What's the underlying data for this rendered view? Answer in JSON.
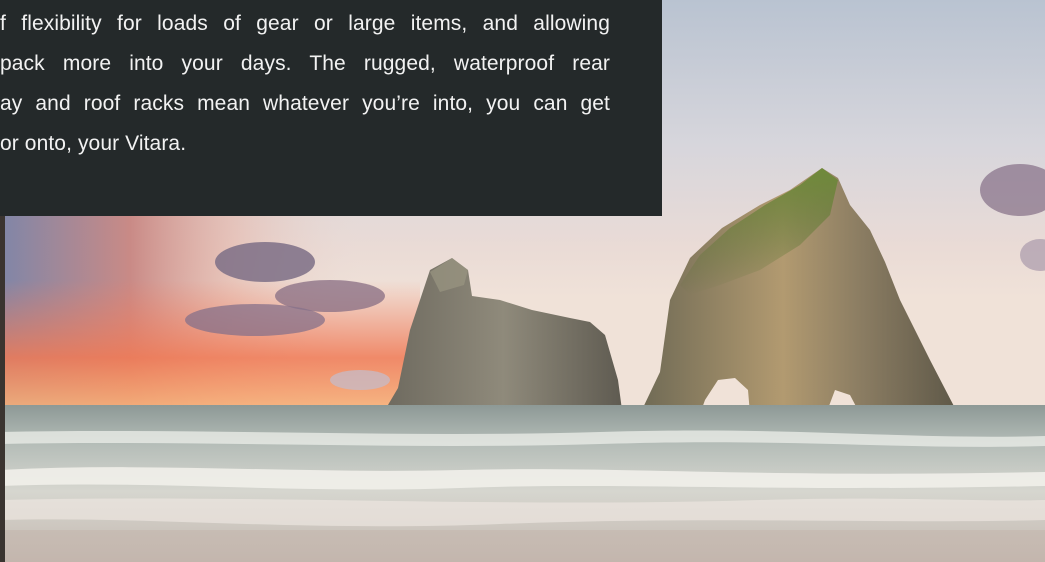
{
  "card": {
    "lines": [
      "f flexibility for loads of gear or large items, and allowing",
      "pack more into your days. The rugged, waterproof rear",
      "ay and roof racks mean whatever you’re into, you can get",
      "or onto, your Vitara."
    ]
  },
  "scene": {
    "description_colors": {
      "card_bg": "#24292a",
      "sky_top": "#c9cfd8",
      "sunset": "#ef8f6a",
      "sea": "#b8c0c0"
    }
  }
}
